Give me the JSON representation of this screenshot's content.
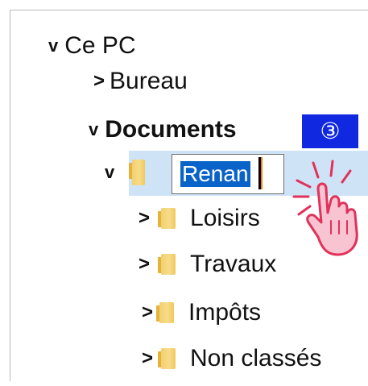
{
  "tree": {
    "root": {
      "chevron": "v",
      "label": "Ce PC"
    },
    "bureau": {
      "chevron": ">",
      "label": "Bureau"
    },
    "documents": {
      "chevron": "v",
      "label": "Documents"
    },
    "renaming": {
      "chevron": "v",
      "value": "Renan"
    },
    "children": [
      {
        "chevron": ">",
        "label": "Loisirs"
      },
      {
        "chevron": ">",
        "label": "Travaux"
      },
      {
        "chevron": ">",
        "label": "Impôts"
      },
      {
        "chevron": ">",
        "label": "Non classés"
      }
    ]
  },
  "step_badge": "③",
  "colors": {
    "selection_band": "#cfe3f7",
    "text_selection": "#0a63c9",
    "badge": "#1029e0",
    "folder": "#f3cf6e",
    "hand_outline": "#e0325a"
  },
  "icons": {
    "folder": "folder-icon",
    "pointer": "pointing-hand-icon"
  }
}
